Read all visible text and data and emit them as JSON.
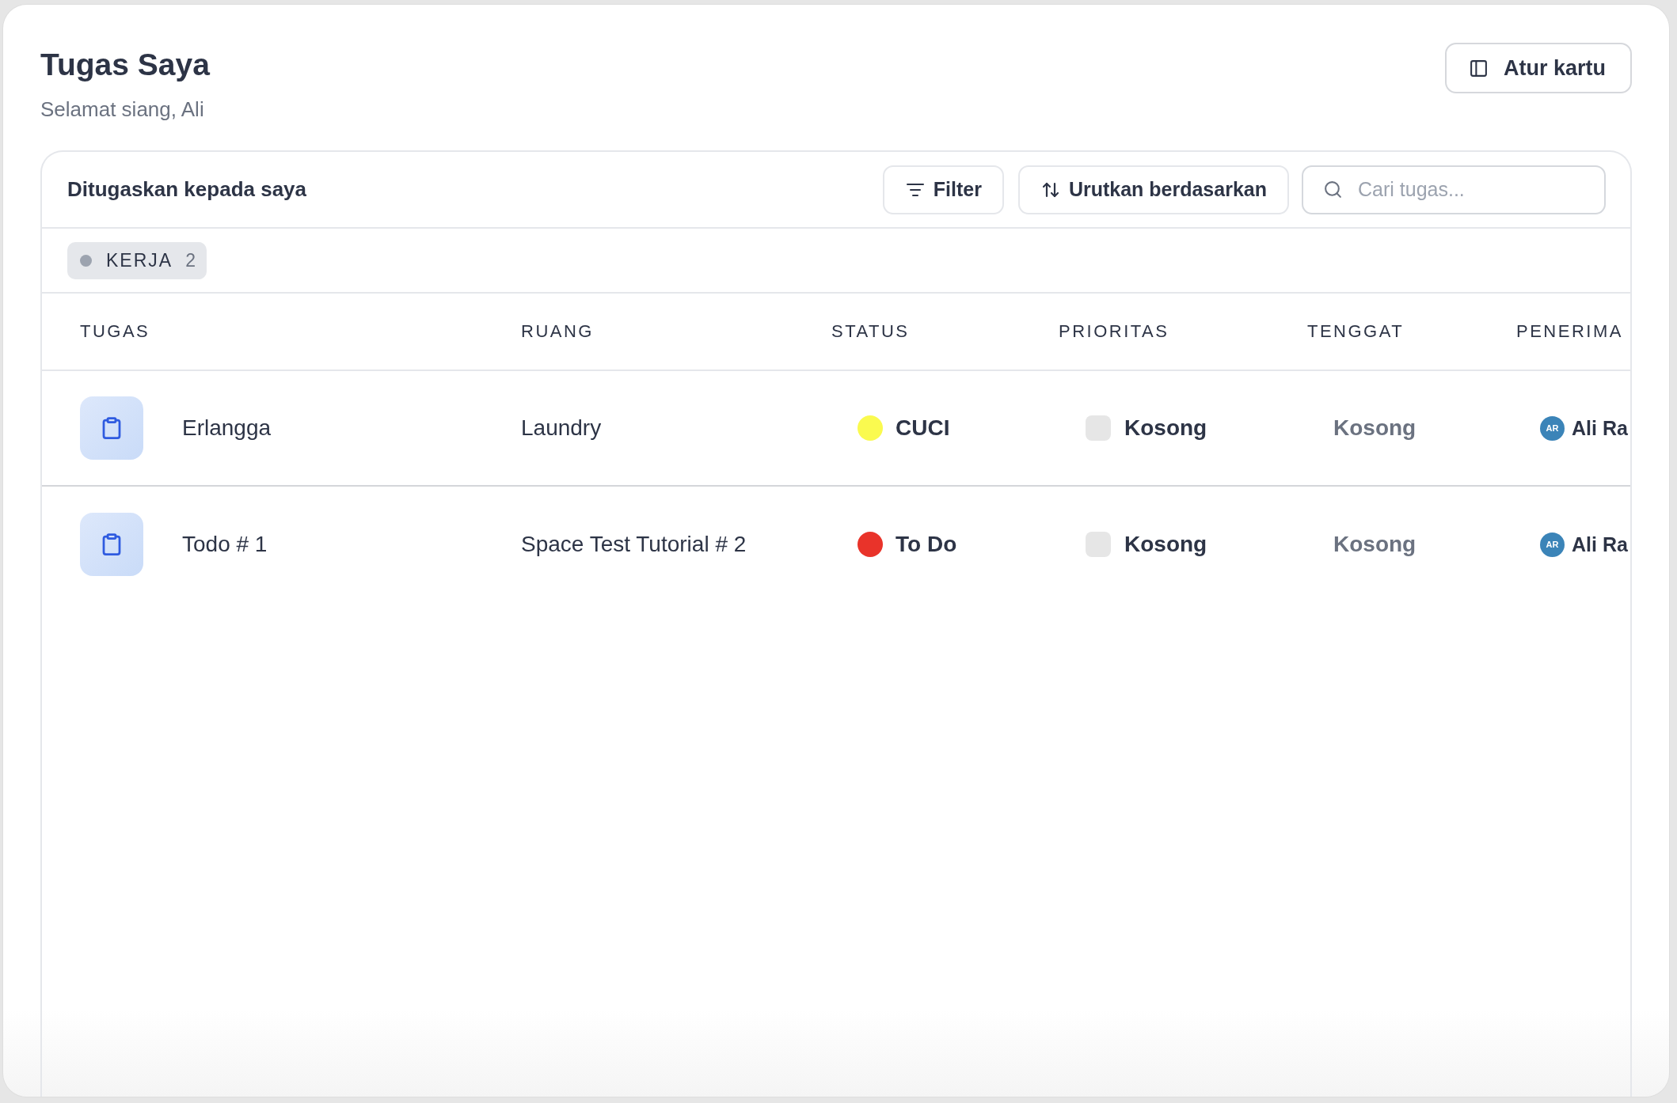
{
  "page": {
    "title": "Tugas Saya",
    "greeting": "Selamat siang, Ali"
  },
  "customize_button": {
    "label": "Atur kartu"
  },
  "panel": {
    "title": "Ditugaskan kepada saya",
    "toolbar": {
      "filter_button": "Filter",
      "sort_button": "Urutkan berdasarkan",
      "search": {
        "placeholder": "Cari tugas..."
      }
    },
    "group": {
      "label": "KERJA",
      "count": "2"
    },
    "table": {
      "columns": [
        "TUGAS",
        "RUANG",
        "STATUS",
        "PRIORITAS",
        "TENGGAT",
        "PENERIMA"
      ],
      "rows": [
        {
          "task": "Erlangga",
          "space": "Laundry",
          "status": {
            "label": "CUCI",
            "color": "#fafa4f"
          },
          "priority": "Kosong",
          "due": "Kosong",
          "assignee": {
            "initials": "AR",
            "name": "Ali Ra"
          }
        },
        {
          "task": "Todo # 1",
          "space": "Space Test Tutorial # 2",
          "status": {
            "label": "To Do",
            "color": "#e9332a"
          },
          "priority": "Kosong",
          "due": "Kosong",
          "assignee": {
            "initials": "AR",
            "name": "Ali Ra"
          }
        }
      ]
    }
  }
}
